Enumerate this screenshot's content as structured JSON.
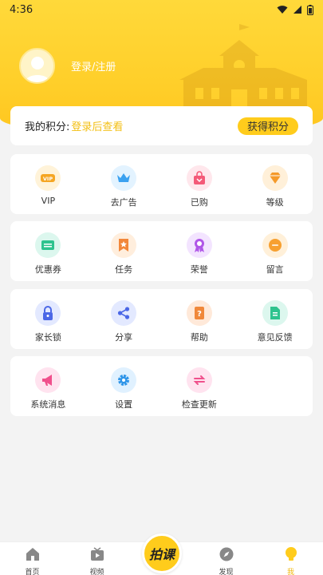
{
  "status": {
    "time": "4:36"
  },
  "profile": {
    "login_text": "登录/注册"
  },
  "points": {
    "label": "我的积分:",
    "value": "登录后查看",
    "button": "获得积分"
  },
  "sections": [
    {
      "items": [
        {
          "label": "VIP",
          "icon": "vip-icon"
        },
        {
          "label": "去广告",
          "icon": "crown-icon"
        },
        {
          "label": "已购",
          "icon": "shopping-bag-icon"
        },
        {
          "label": "等级",
          "icon": "diamond-icon"
        }
      ]
    },
    {
      "items": [
        {
          "label": "优惠券",
          "icon": "coupon-icon"
        },
        {
          "label": "任务",
          "icon": "bookmark-star-icon"
        },
        {
          "label": "荣誉",
          "icon": "medal-icon"
        },
        {
          "label": "留言",
          "icon": "message-icon"
        }
      ]
    },
    {
      "items": [
        {
          "label": "家长锁",
          "icon": "lock-icon"
        },
        {
          "label": "分享",
          "icon": "share-icon"
        },
        {
          "label": "帮助",
          "icon": "help-book-icon"
        },
        {
          "label": "意见反馈",
          "icon": "feedback-doc-icon"
        }
      ]
    },
    {
      "items": [
        {
          "label": "系统消息",
          "icon": "megaphone-icon"
        },
        {
          "label": "设置",
          "icon": "gear-icon"
        },
        {
          "label": "检查更新",
          "icon": "refresh-arrows-icon"
        }
      ]
    }
  ],
  "tabbar": {
    "tabs": [
      {
        "label": "首页",
        "icon": "home-icon"
      },
      {
        "label": "视频",
        "icon": "tv-icon"
      },
      {
        "label": "",
        "icon": "center"
      },
      {
        "label": "发现",
        "icon": "compass-icon"
      },
      {
        "label": "我",
        "icon": "bulb-person-icon"
      }
    ],
    "center_label": "拍课"
  },
  "colors": {
    "brand": "#ffcc1c",
    "accent_text": "#f3bf13"
  }
}
